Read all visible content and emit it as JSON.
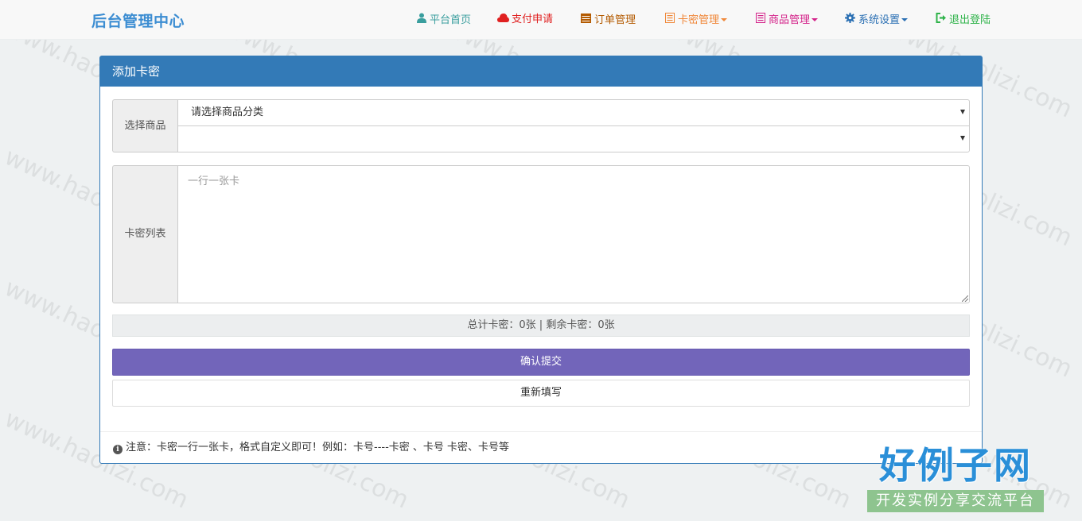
{
  "brand": "后台管理中心",
  "nav": [
    {
      "label": "平台首页",
      "icon": "user-icon",
      "color": "#3a9e9e"
    },
    {
      "label": "支付申请",
      "icon": "cloud-icon",
      "color": "#e02020"
    },
    {
      "label": "订单管理",
      "icon": "calendar-icon",
      "color": "#b35a00"
    },
    {
      "label": "卡密管理",
      "icon": "list-icon",
      "color": "#f0883a"
    },
    {
      "label": "商品管理",
      "icon": "list-icon",
      "color": "#d4238a"
    },
    {
      "label": "系统设置",
      "icon": "gear-icon",
      "color": "#2a6fb3"
    },
    {
      "label": "退出登陆",
      "icon": "logout-icon",
      "color": "#2fb34a"
    }
  ],
  "panel": {
    "title": "添加卡密",
    "select_label": "选择商品",
    "category_select": "请选择商品分类",
    "product_select": "",
    "list_label": "卡密列表",
    "textarea_placeholder": "一行一张卡",
    "stats": "总计卡密：0张 | 剩余卡密：0张",
    "submit_label": "确认提交",
    "reset_label": "重新填写",
    "note": "注意：卡密一行一张卡，格式自定义即可！例如：卡号----卡密 、卡号 卡密、卡号等"
  },
  "watermark": "www.haolizi.com",
  "logo": {
    "main": "好例子网",
    "sub": "开发实例分享交流平台"
  }
}
